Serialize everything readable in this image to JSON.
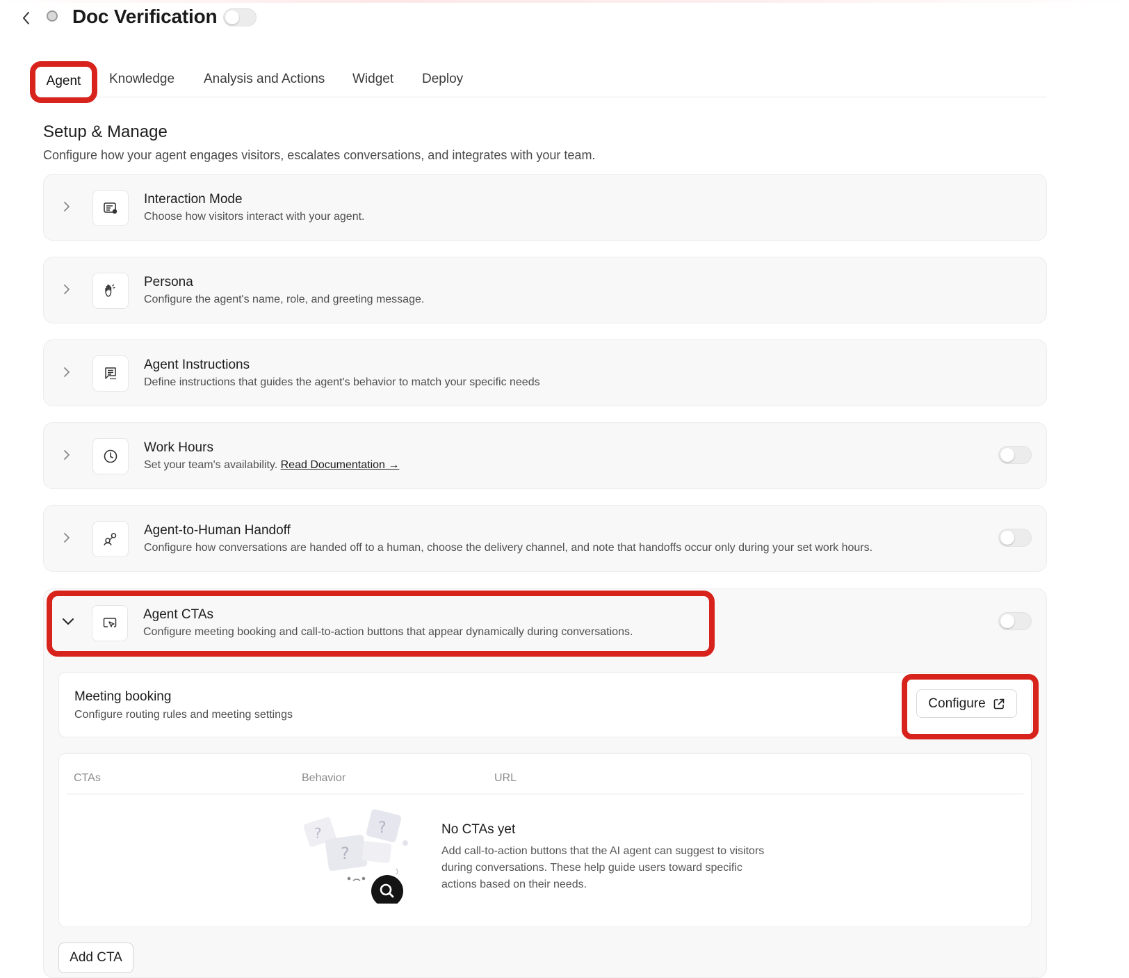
{
  "header": {
    "title": "Doc Verification"
  },
  "tabs": [
    {
      "label": "Agent",
      "active": true
    },
    {
      "label": "Knowledge"
    },
    {
      "label": "Analysis and Actions"
    },
    {
      "label": "Widget"
    },
    {
      "label": "Deploy"
    }
  ],
  "section": {
    "title": "Setup & Manage",
    "subtitle": "Configure how your agent engages visitors, escalates conversations, and integrates with your team."
  },
  "cards": [
    {
      "title": "Interaction Mode",
      "desc": "Choose how visitors interact with your agent.",
      "icon": "chat-document-icon"
    },
    {
      "title": "Persona",
      "desc": "Configure the agent's name, role, and greeting message.",
      "icon": "waving-hand-icon"
    },
    {
      "title": "Agent Instructions",
      "desc": "Define instructions that guides the agent's behavior to match your specific needs",
      "icon": "instructions-icon"
    },
    {
      "title": "Work Hours",
      "desc": "Set your team's availability. ",
      "link": "Read Documentation →",
      "icon": "clock-icon",
      "toggle": false
    },
    {
      "title": "Agent-to-Human Handoff",
      "desc": "Configure how conversations are handed off to a human, choose the delivery channel, and note that handoffs occur only during your set work hours.",
      "icon": "handoff-icon",
      "toggle": false
    },
    {
      "title": "Agent CTAs",
      "desc": "Configure meeting booking and call-to-action buttons that appear dynamically during conversations.",
      "icon": "cursor-screen-icon",
      "toggle": false,
      "expanded": true
    }
  ],
  "meeting": {
    "title": "Meeting booking",
    "desc": "Configure routing rules and meeting settings",
    "button": "Configure"
  },
  "cta_table": {
    "columns": [
      "CTAs",
      "Behavior",
      "URL"
    ],
    "empty_title": "No CTAs yet",
    "empty_desc": "Add call-to-action buttons that the AI agent can suggest to visitors during conversations. These help guide users toward specific actions based on their needs."
  },
  "add_button": "Add CTA",
  "colors": {
    "highlight": "#d7231c",
    "card_bg": "#f8f8f8"
  }
}
